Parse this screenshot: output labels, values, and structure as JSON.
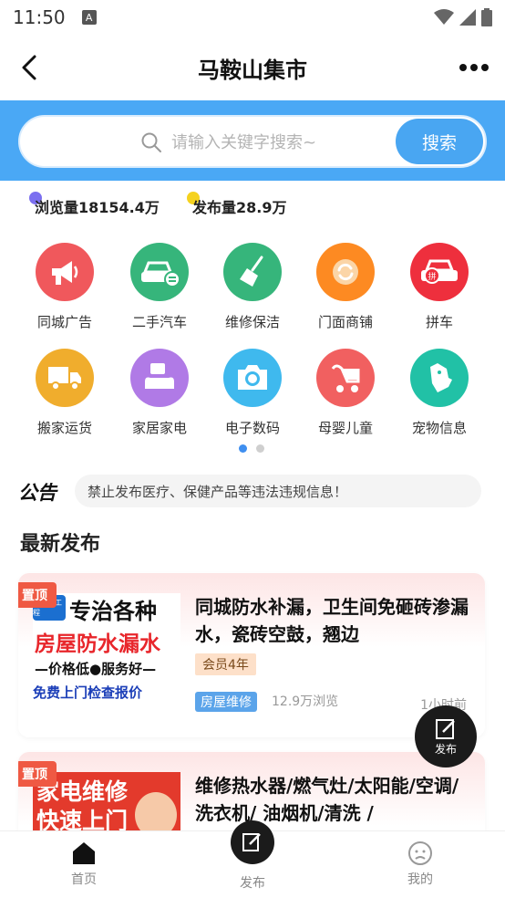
{
  "status_bar": {
    "time": "11:50",
    "notif_letter": "A"
  },
  "header": {
    "title": "马鞍山集市"
  },
  "search": {
    "placeholder": "请输入关键字搜索~",
    "button_label": "搜索"
  },
  "stats": {
    "views_label": "浏览量18154.4万",
    "posts_label": "发布量28.9万",
    "views_dot_color": "#7b6ff0",
    "posts_dot_color": "#f5d21e"
  },
  "categories": [
    {
      "label": "同城广告",
      "icon": "megaphone-icon",
      "color": "#f0585c"
    },
    {
      "label": "二手汽车",
      "icon": "car-icon",
      "color": "#36b57b"
    },
    {
      "label": "维修保洁",
      "icon": "broom-icon",
      "color": "#36b57b"
    },
    {
      "label": "门面商铺",
      "icon": "shop-icon",
      "color": "#fd8a22"
    },
    {
      "label": "拼车",
      "icon": "carpool-icon",
      "color": "#ee2f3d"
    },
    {
      "label": "搬家运货",
      "icon": "truck-icon",
      "color": "#f0ad2d"
    },
    {
      "label": "家居家电",
      "icon": "sofa-tv-icon",
      "color": "#b07ae6"
    },
    {
      "label": "电子数码",
      "icon": "camera-icon",
      "color": "#3fb9ee"
    },
    {
      "label": "母婴儿童",
      "icon": "stroller-icon",
      "color": "#f16060"
    },
    {
      "label": "宠物信息",
      "icon": "dog-icon",
      "color": "#21c1a6"
    }
  ],
  "pager": {
    "active_color": "#3f8ff0",
    "inactive_color": "#cfcfcf"
  },
  "notice": {
    "logo_text": "公告",
    "text": "禁止发布医疗、保健产品等违法违规信息！"
  },
  "latest": {
    "section_title": "最新发布"
  },
  "posts": [
    {
      "pin_label": "置顶",
      "thumb_lines": [
        "专治各种",
        "房屋防水漏水",
        "—价格低●服务好—",
        "免费上门检查报价"
      ],
      "thumb_corner": "马鞍山工程",
      "title": "同城防水补漏，卫生间免砸砖渗漏水，瓷砖空鼓，翘边",
      "member_label": "会员4年",
      "tag": "房屋维修",
      "views": "12.9万浏览",
      "time_ago": "1小时前"
    },
    {
      "pin_label": "置顶",
      "thumb_lines": [
        "家电维修",
        "快速上门"
      ],
      "title": "维修热水器/燃气灶/太阳能/空调/洗衣机/ 油烟机/清洗 /"
    }
  ],
  "float_button": {
    "label": "发布"
  },
  "tab_bar": {
    "home": "首页",
    "publish": "发布",
    "mine": "我的"
  }
}
